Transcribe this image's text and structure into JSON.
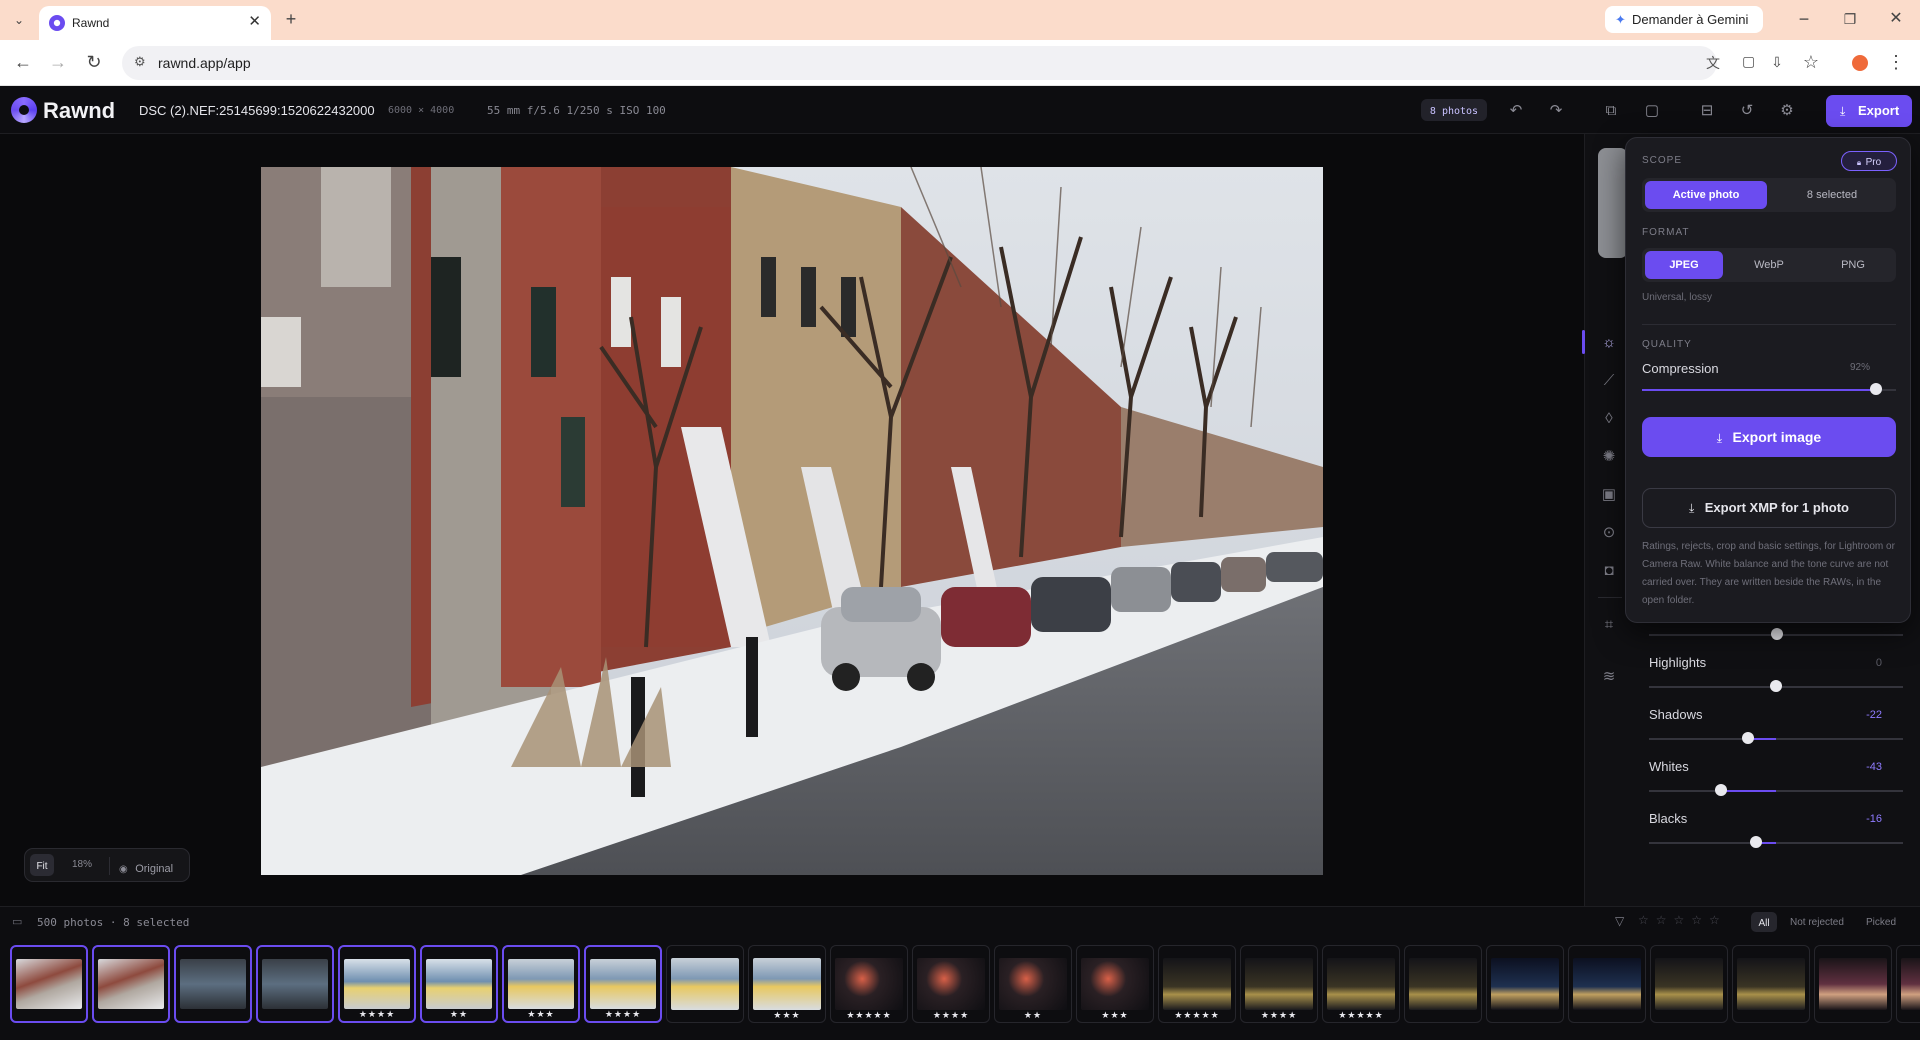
{
  "browser": {
    "tab_title": "Rawnd",
    "url": "rawnd.app/app",
    "gemini_button": "Demander à Gemini"
  },
  "app": {
    "brand": "Rawnd",
    "file_name": "DSC (2).NEF:25145699:1520622432000",
    "dimensions": "6000 × 4000",
    "exif": "55 mm f/5.6 1/250 s ISO 100",
    "photos_badge": "8 photos",
    "export_button": "Export"
  },
  "export_popover": {
    "scope_label": "SCOPE",
    "pro_badge": "Pro",
    "scope_options": [
      "Active photo",
      "8 selected"
    ],
    "scope_selected": "Active photo",
    "format_label": "FORMAT",
    "format_options": [
      "JPEG",
      "WebP",
      "PNG"
    ],
    "format_selected": "JPEG",
    "format_hint": "Universal, lossy",
    "quality_label": "QUALITY",
    "compression_label": "Compression",
    "compression_value": "92%",
    "compression_level": 0.92,
    "export_image_button": "Export image",
    "export_xmp_button": "Export XMP for 1 photo",
    "xmp_description": "Ratings, rejects, crop and basic settings, for Lightroom or Camera Raw. White balance and the tone curve are not carried over. They are written beside the RAWs, in the open folder."
  },
  "adjustments": [
    {
      "label": "Highlights",
      "value": "0",
      "level": 0
    },
    {
      "label": "Shadows",
      "value": "-22",
      "level": -22
    },
    {
      "label": "Whites",
      "value": "-43",
      "level": -43
    },
    {
      "label": "Blacks",
      "value": "-16",
      "level": -16
    }
  ],
  "zoom": {
    "fit_label": "Fit",
    "percent": "18%",
    "original_label": "Original"
  },
  "filmstrip": {
    "summary": "500 photos · 8 selected",
    "filter_tabs": [
      "All",
      "Not rejected",
      "Picked"
    ],
    "filter_selected": "All",
    "thumbnails": [
      {
        "scene": "street",
        "stars": "",
        "selected": true
      },
      {
        "scene": "street",
        "stars": "",
        "selected": true
      },
      {
        "scene": "train-dark",
        "stars": "",
        "selected": true
      },
      {
        "scene": "train-dark",
        "stars": "",
        "selected": true
      },
      {
        "scene": "train",
        "stars": "★★★★",
        "selected": true
      },
      {
        "scene": "train",
        "stars": "★★",
        "selected": true
      },
      {
        "scene": "train-blur",
        "stars": "★★★",
        "selected": true
      },
      {
        "scene": "train-blur",
        "stars": "★★★★",
        "selected": true
      },
      {
        "scene": "train-blur",
        "stars": "",
        "selected": false
      },
      {
        "scene": "train-blur",
        "stars": "★★★",
        "selected": false
      },
      {
        "scene": "night",
        "stars": "★★★★★",
        "selected": false
      },
      {
        "scene": "night",
        "stars": "★★★★",
        "selected": false
      },
      {
        "scene": "night",
        "stars": "★★",
        "selected": false
      },
      {
        "scene": "night",
        "stars": "★★★",
        "selected": false
      },
      {
        "scene": "night-road",
        "stars": "★★★★★",
        "selected": false
      },
      {
        "scene": "night-road",
        "stars": "★★★★",
        "selected": false
      },
      {
        "scene": "night-road",
        "stars": "★★★★★",
        "selected": false
      },
      {
        "scene": "night-road",
        "stars": "",
        "selected": false
      },
      {
        "scene": "night-blue",
        "stars": "",
        "selected": false
      },
      {
        "scene": "night-blue",
        "stars": "",
        "selected": false
      },
      {
        "scene": "night-road",
        "stars": "",
        "selected": false
      },
      {
        "scene": "night-road",
        "stars": "",
        "selected": false
      },
      {
        "scene": "night-red",
        "stars": "",
        "selected": false
      },
      {
        "scene": "night-red",
        "stars": "",
        "selected": false
      }
    ]
  }
}
